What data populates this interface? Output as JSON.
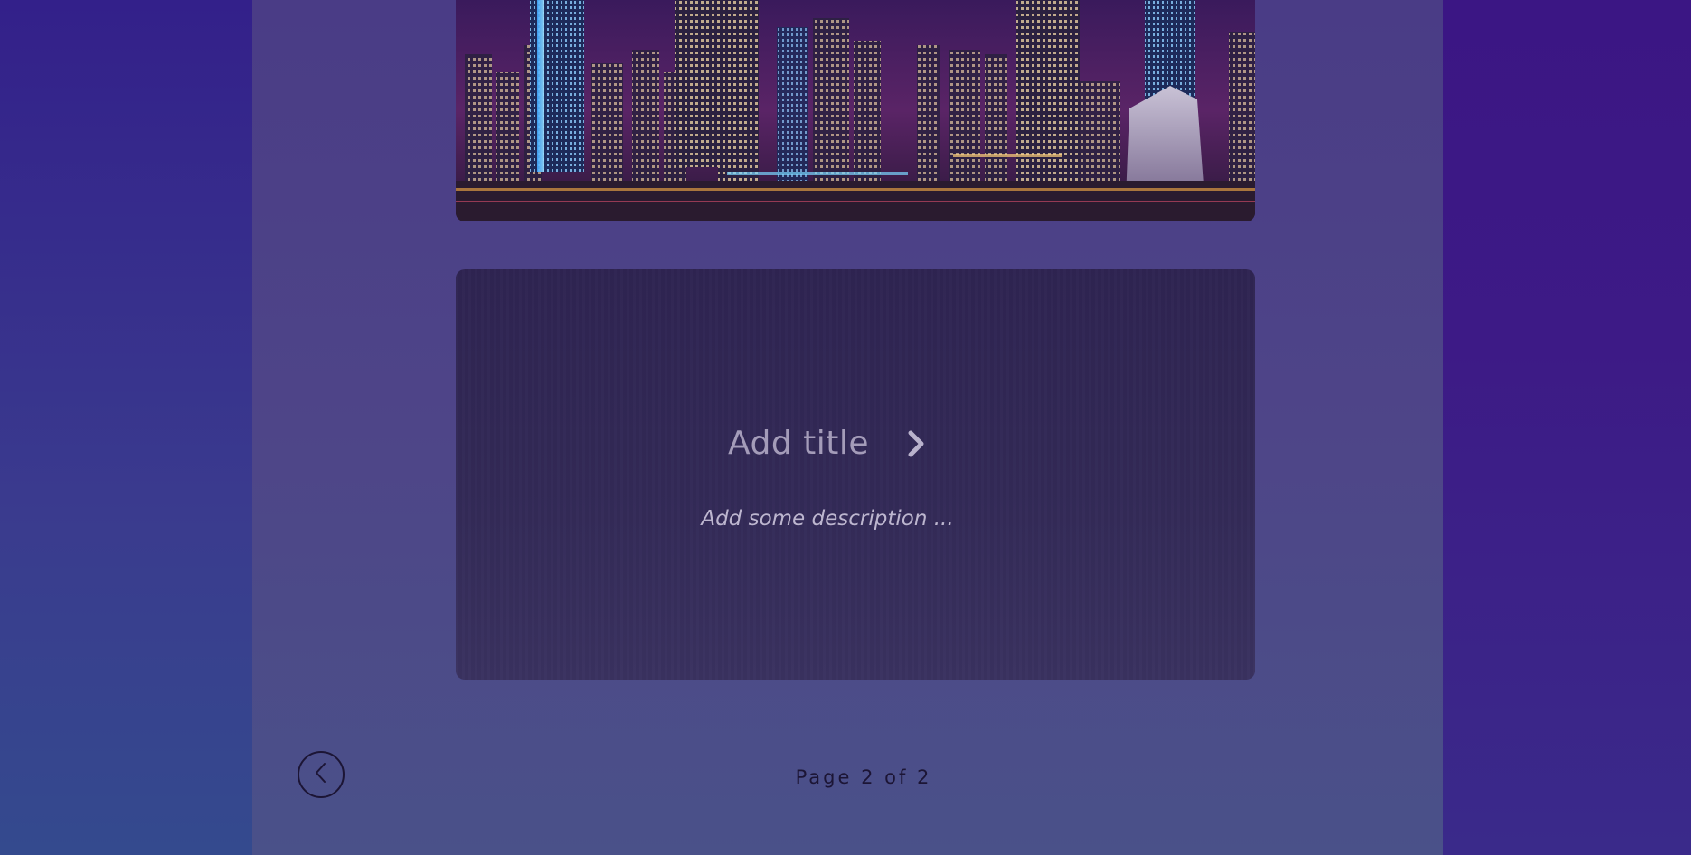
{
  "card": {
    "title": "Add title",
    "description": "Add some description ..."
  },
  "pagination": {
    "label": "Page 2 of 2"
  },
  "icons": {
    "next": "chevron-right-icon",
    "back": "circle-chevron-left-icon"
  },
  "colors": {
    "panel": "#4e4588",
    "card": "#332a57",
    "title": "#a49cb9",
    "description": "#bdb6cf",
    "pager_text": "#1c1535"
  }
}
